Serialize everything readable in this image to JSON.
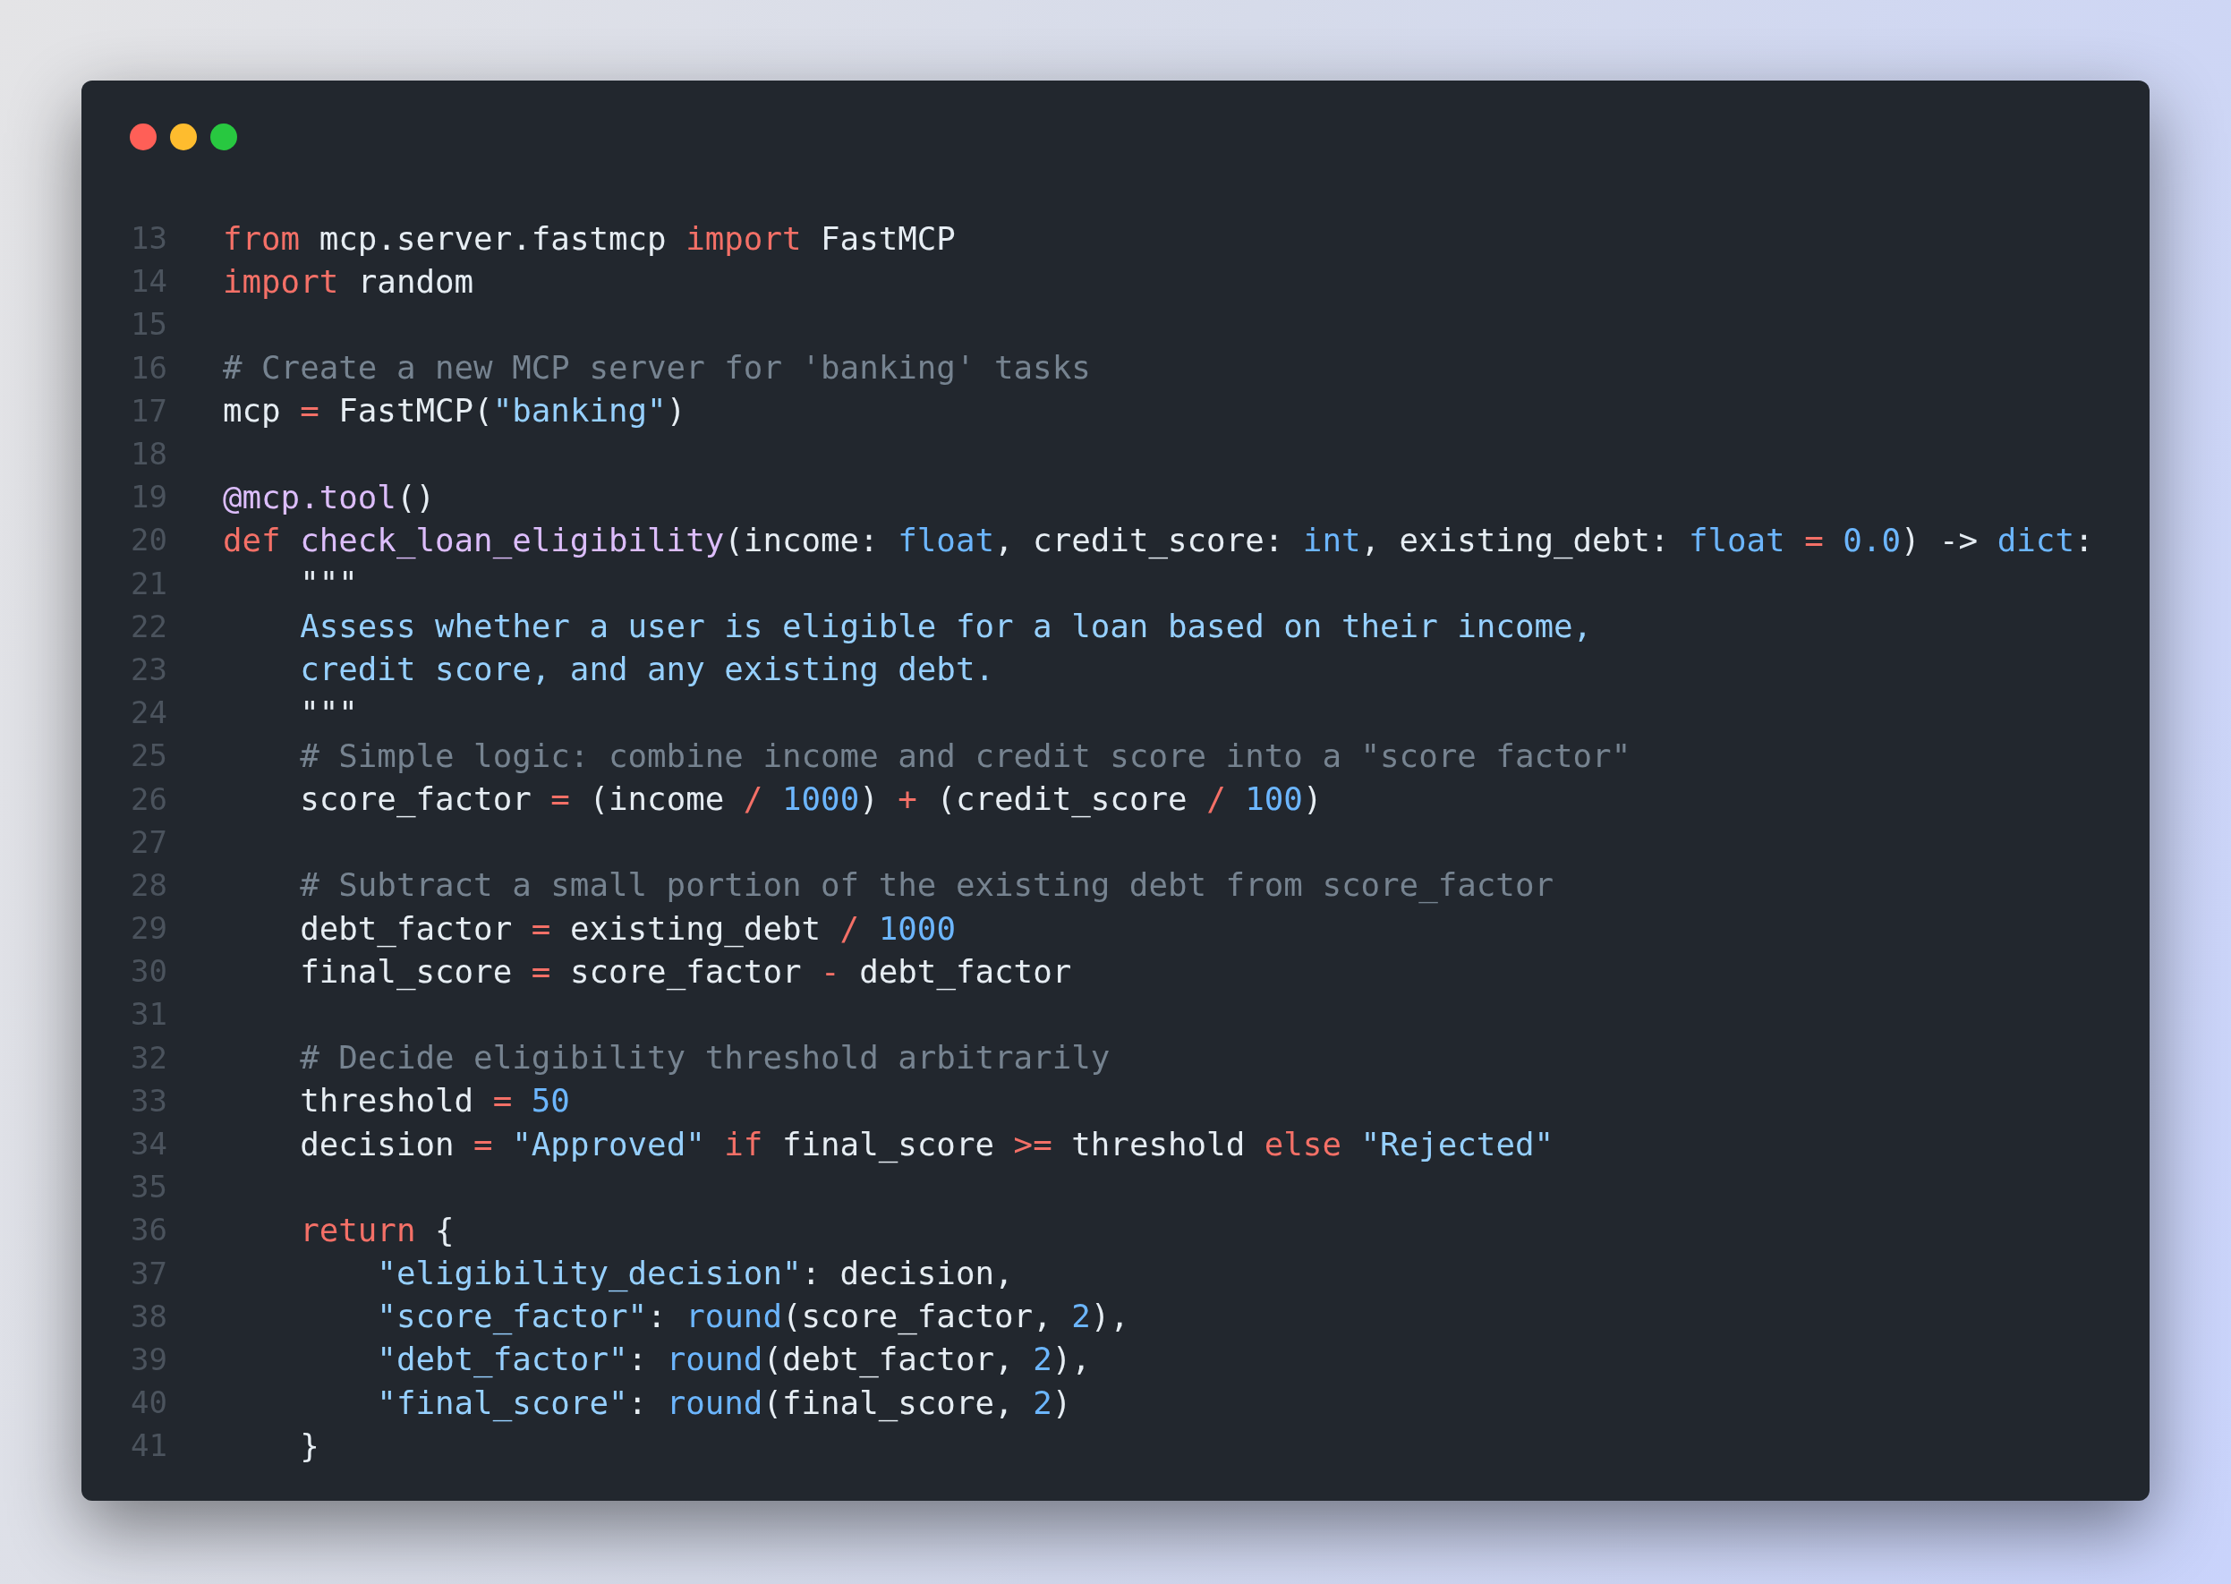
{
  "window": {
    "controls": [
      {
        "kind": "close"
      },
      {
        "kind": "minimize"
      },
      {
        "kind": "zoom"
      }
    ]
  },
  "lines": [
    {
      "number": "13",
      "tokens": [
        {
          "kind": "keyword",
          "text": "from"
        },
        {
          "kind": "plain",
          "text": " mcp.server.fastmcp "
        },
        {
          "kind": "keyword",
          "text": "import"
        },
        {
          "kind": "plain",
          "text": " FastMCP"
        }
      ]
    },
    {
      "number": "14",
      "tokens": [
        {
          "kind": "keyword",
          "text": "import"
        },
        {
          "kind": "plain",
          "text": " random"
        }
      ]
    },
    {
      "number": "15"
    },
    {
      "number": "16",
      "tokens": [
        {
          "kind": "comment",
          "text": "# Create a new MCP server for 'banking' tasks"
        }
      ]
    },
    {
      "number": "17",
      "tokens": [
        {
          "kind": "plain",
          "text": "mcp "
        },
        {
          "kind": "operator",
          "text": "="
        },
        {
          "kind": "plain",
          "text": " FastMCP("
        },
        {
          "kind": "string",
          "text": "\"banking\""
        },
        {
          "kind": "plain",
          "text": ")"
        }
      ]
    },
    {
      "number": "18"
    },
    {
      "number": "19",
      "tokens": [
        {
          "kind": "decorator",
          "text": "@mcp.tool"
        },
        {
          "kind": "plain",
          "text": "()"
        }
      ]
    },
    {
      "number": "20",
      "tokens": [
        {
          "kind": "keyword",
          "text": "def"
        },
        {
          "kind": "function",
          "text": " check_loan_eligibility"
        },
        {
          "kind": "plain",
          "text": "(income: "
        },
        {
          "kind": "type",
          "text": "float"
        },
        {
          "kind": "plain",
          "text": ", credit_score: "
        },
        {
          "kind": "type",
          "text": "int"
        },
        {
          "kind": "plain",
          "text": ", existing_debt: "
        },
        {
          "kind": "type",
          "text": "float"
        },
        {
          "kind": "operator",
          "text": " = "
        },
        {
          "kind": "number",
          "text": "0.0"
        },
        {
          "kind": "plain",
          "text": ") -> "
        },
        {
          "kind": "type",
          "text": "dict"
        },
        {
          "kind": "plain",
          "text": ":"
        }
      ]
    },
    {
      "number": "21",
      "tokens": [
        {
          "kind": "plain",
          "text": "    \"\"\""
        }
      ]
    },
    {
      "number": "22",
      "tokens": [
        {
          "kind": "docstring",
          "text": "    Assess whether a user is eligible for a loan based on their income,"
        }
      ]
    },
    {
      "number": "23",
      "tokens": [
        {
          "kind": "docstring",
          "text": "    credit score, and any existing debt."
        }
      ]
    },
    {
      "number": "24",
      "tokens": [
        {
          "kind": "plain",
          "text": "    \"\"\""
        }
      ]
    },
    {
      "number": "25",
      "tokens": [
        {
          "kind": "comment",
          "text": "    # Simple logic: combine income and credit score into a \"score factor\""
        }
      ]
    },
    {
      "number": "26",
      "tokens": [
        {
          "kind": "plain",
          "text": "    score_factor "
        },
        {
          "kind": "operator",
          "text": "="
        },
        {
          "kind": "plain",
          "text": " (income "
        },
        {
          "kind": "operator",
          "text": "/"
        },
        {
          "kind": "number",
          "text": " 1000"
        },
        {
          "kind": "plain",
          "text": ") "
        },
        {
          "kind": "operator",
          "text": "+"
        },
        {
          "kind": "plain",
          "text": " (credit_score "
        },
        {
          "kind": "operator",
          "text": "/"
        },
        {
          "kind": "number",
          "text": " 100"
        },
        {
          "kind": "plain",
          "text": ")"
        }
      ]
    },
    {
      "number": "27"
    },
    {
      "number": "28",
      "tokens": [
        {
          "kind": "comment",
          "text": "    # Subtract a small portion of the existing debt from score_factor"
        }
      ]
    },
    {
      "number": "29",
      "tokens": [
        {
          "kind": "plain",
          "text": "    debt_factor "
        },
        {
          "kind": "operator",
          "text": "="
        },
        {
          "kind": "plain",
          "text": " existing_debt "
        },
        {
          "kind": "operator",
          "text": "/"
        },
        {
          "kind": "number",
          "text": " 1000"
        }
      ]
    },
    {
      "number": "30",
      "tokens": [
        {
          "kind": "plain",
          "text": "    final_score "
        },
        {
          "kind": "operator",
          "text": "="
        },
        {
          "kind": "plain",
          "text": " score_factor "
        },
        {
          "kind": "operator",
          "text": "-"
        },
        {
          "kind": "plain",
          "text": " debt_factor"
        }
      ]
    },
    {
      "number": "31"
    },
    {
      "number": "32",
      "tokens": [
        {
          "kind": "comment",
          "text": "    # Decide eligibility threshold arbitrarily"
        }
      ]
    },
    {
      "number": "33",
      "tokens": [
        {
          "kind": "plain",
          "text": "    threshold "
        },
        {
          "kind": "operator",
          "text": "="
        },
        {
          "kind": "number",
          "text": " 50"
        }
      ]
    },
    {
      "number": "34",
      "tokens": [
        {
          "kind": "plain",
          "text": "    decision "
        },
        {
          "kind": "operator",
          "text": "="
        },
        {
          "kind": "string",
          "text": " \"Approved\""
        },
        {
          "kind": "keyword",
          "text": " if"
        },
        {
          "kind": "plain",
          "text": " final_score "
        },
        {
          "kind": "operator",
          "text": ">="
        },
        {
          "kind": "plain",
          "text": " threshold "
        },
        {
          "kind": "keyword",
          "text": "else"
        },
        {
          "kind": "string",
          "text": " \"Rejected\""
        }
      ]
    },
    {
      "number": "35"
    },
    {
      "number": "36",
      "tokens": [
        {
          "kind": "keyword",
          "text": "    return"
        },
        {
          "kind": "plain",
          "text": " {"
        }
      ]
    },
    {
      "number": "37",
      "tokens": [
        {
          "kind": "string",
          "text": "        \"eligibility_decision\""
        },
        {
          "kind": "plain",
          "text": ": decision,"
        }
      ]
    },
    {
      "number": "38",
      "tokens": [
        {
          "kind": "string",
          "text": "        \"score_factor\""
        },
        {
          "kind": "plain",
          "text": ": "
        },
        {
          "kind": "type",
          "text": "round"
        },
        {
          "kind": "plain",
          "text": "(score_factor, "
        },
        {
          "kind": "number",
          "text": "2"
        },
        {
          "kind": "plain",
          "text": "),"
        }
      ]
    },
    {
      "number": "39",
      "tokens": [
        {
          "kind": "string",
          "text": "        \"debt_factor\""
        },
        {
          "kind": "plain",
          "text": ": "
        },
        {
          "kind": "type",
          "text": "round"
        },
        {
          "kind": "plain",
          "text": "(debt_factor, "
        },
        {
          "kind": "number",
          "text": "2"
        },
        {
          "kind": "plain",
          "text": "),"
        }
      ]
    },
    {
      "number": "40",
      "tokens": [
        {
          "kind": "string",
          "text": "        \"final_score\""
        },
        {
          "kind": "plain",
          "text": ": "
        },
        {
          "kind": "type",
          "text": "round"
        },
        {
          "kind": "plain",
          "text": "(final_score, "
        },
        {
          "kind": "number",
          "text": "2"
        },
        {
          "kind": "plain",
          "text": ")"
        }
      ]
    },
    {
      "number": "41",
      "tokens": [
        {
          "kind": "plain",
          "text": "    }"
        }
      ]
    }
  ]
}
